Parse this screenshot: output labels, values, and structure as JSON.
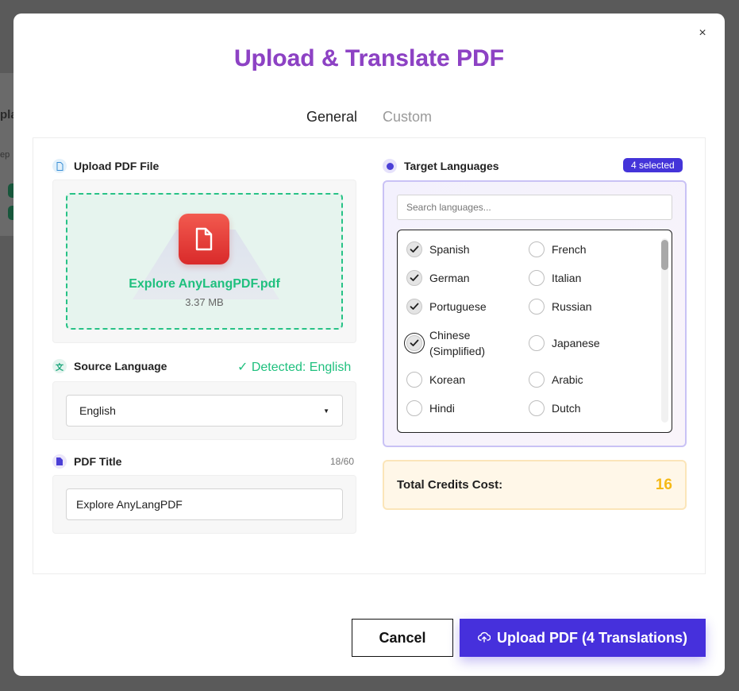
{
  "background": {
    "partial_text_1": "pla",
    "partial_text_2": "ep"
  },
  "modal": {
    "title": "Upload & Translate PDF",
    "close_label": "×",
    "tabs": [
      {
        "label": "General",
        "active": true
      },
      {
        "label": "Custom",
        "active": false
      }
    ]
  },
  "upload": {
    "heading": "Upload PDF File",
    "file_name": "Explore AnyLangPDF.pdf",
    "file_size": "3.37 MB",
    "icon": "pdf-file-icon"
  },
  "source_language": {
    "heading": "Source Language",
    "detected": "✓ Detected: English",
    "selected": "English"
  },
  "pdf_title": {
    "heading": "PDF Title",
    "counter": "18/60",
    "value": "Explore AnyLangPDF"
  },
  "target_languages": {
    "heading": "Target Languages",
    "badge": "4 selected",
    "search_placeholder": "Search languages...",
    "languages": [
      {
        "label": "Spanish",
        "checked": true
      },
      {
        "label": "French",
        "checked": false
      },
      {
        "label": "German",
        "checked": true
      },
      {
        "label": "Italian",
        "checked": false
      },
      {
        "label": "Portuguese",
        "checked": true
      },
      {
        "label": "Russian",
        "checked": false
      },
      {
        "label": "Chinese (Simplified)",
        "checked": true
      },
      {
        "label": "Japanese",
        "checked": false
      },
      {
        "label": "Korean",
        "checked": false
      },
      {
        "label": "Arabic",
        "checked": false
      },
      {
        "label": "Hindi",
        "checked": false
      },
      {
        "label": "Dutch",
        "checked": false
      }
    ]
  },
  "credits": {
    "label": "Total Credits Cost:",
    "value": "16"
  },
  "actions": {
    "cancel": "Cancel",
    "upload": "Upload PDF (4 Translations)"
  },
  "colors": {
    "accent": "#4630dc",
    "success": "#1fc07e",
    "title": "#8d42c4",
    "credits": "#f5b915"
  }
}
